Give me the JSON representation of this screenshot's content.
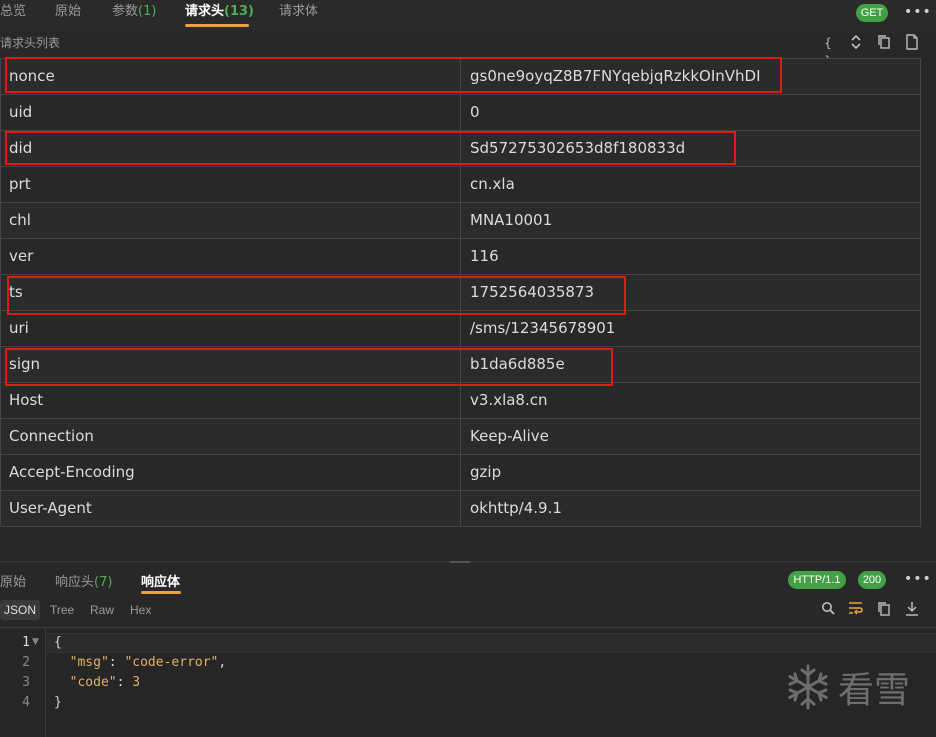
{
  "request_tabs": [
    {
      "label": "总览",
      "count": ""
    },
    {
      "label": "原始",
      "count": ""
    },
    {
      "label": "参数",
      "count": "(1)"
    },
    {
      "label": "请求头",
      "count": "(13)"
    },
    {
      "label": "请求体",
      "count": ""
    }
  ],
  "method_badge": "GET",
  "more_glyph": "•••",
  "section_title": "请求头列表",
  "toolbar_icons": [
    "braces-icon",
    "expand-collapse-icon",
    "copy-icon",
    "file-icon"
  ],
  "headers": [
    {
      "key": "nonce",
      "value": "gs0ne9oyqZ8B7FNYqebjqRzkkOInVhDI"
    },
    {
      "key": "uid",
      "value": "0"
    },
    {
      "key": "did",
      "value": "Sd57275302653d8f180833d"
    },
    {
      "key": "prt",
      "value": "cn.xla"
    },
    {
      "key": "chl",
      "value": "MNA10001"
    },
    {
      "key": "ver",
      "value": "116"
    },
    {
      "key": "ts",
      "value": "1752564035873"
    },
    {
      "key": "uri",
      "value": "/sms/12345678901"
    },
    {
      "key": "sign",
      "value": "b1da6d885e"
    },
    {
      "key": "Host",
      "value": "v3.xla8.cn"
    },
    {
      "key": "Connection",
      "value": "Keep-Alive"
    },
    {
      "key": "Accept-Encoding",
      "value": "gzip"
    },
    {
      "key": "User-Agent",
      "value": "okhttp/4.9.1"
    }
  ],
  "highlight_color": "#e01919",
  "response_tabs": [
    {
      "label": "原始",
      "count": ""
    },
    {
      "label": "响应头",
      "count": "(7)"
    },
    {
      "label": "响应体",
      "count": ""
    }
  ],
  "protocol_badge": "HTTP/1.1",
  "status_badge": "200",
  "formats": [
    "JSON",
    "Tree",
    "Raw",
    "Hex"
  ],
  "response_icons": [
    "search-icon",
    "wrap-icon",
    "copy-icon",
    "download-icon"
  ],
  "code_lines": [
    {
      "num": "1",
      "text": "{"
    },
    {
      "num": "2",
      "key": "\"msg\"",
      "sep": ": ",
      "val": "\"code-error\"",
      "tail": ","
    },
    {
      "num": "3",
      "key": "\"code\"",
      "sep": ": ",
      "val": "3",
      "tail": ""
    },
    {
      "num": "4",
      "text": "}"
    }
  ],
  "watermark": "看雪",
  "accent_color": "#e8a33d",
  "badge_color": "#43a047"
}
